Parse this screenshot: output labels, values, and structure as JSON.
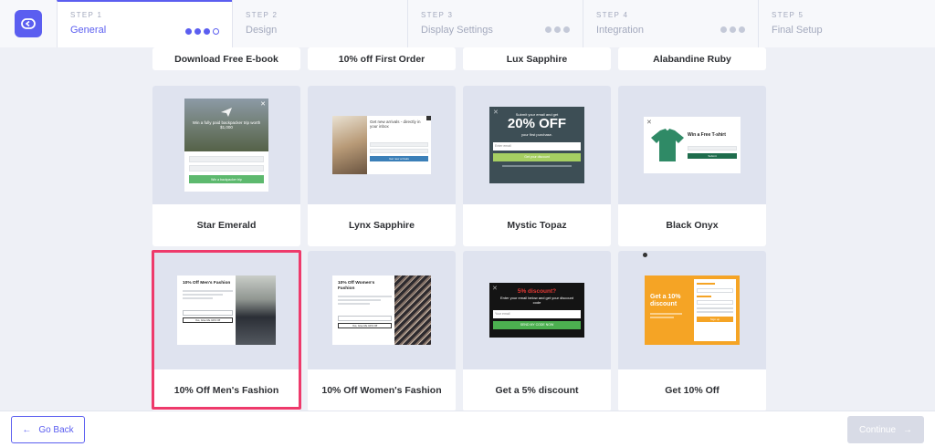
{
  "steps": [
    {
      "num": "STEP 1",
      "label": "General",
      "active": true
    },
    {
      "num": "STEP 2",
      "label": "Design"
    },
    {
      "num": "STEP 3",
      "label": "Display Settings"
    },
    {
      "num": "STEP 4",
      "label": "Integration"
    },
    {
      "num": "STEP 5",
      "label": "Final Setup"
    }
  ],
  "templates": {
    "row0": [
      "Download Free E-book",
      "10% off First Order",
      "Lux Sapphire",
      "Alabandine Ruby"
    ],
    "row1": [
      "Star Emerald",
      "Lynx Sapphire",
      "Mystic Topaz",
      "Black Onyx"
    ],
    "row2": [
      "10% Off Men's Fashion",
      "10% Off Women's Fashion",
      "Get a 5% discount",
      "Get 10% Off"
    ],
    "selected": "10% Off Men's Fashion"
  },
  "previews": {
    "star_emerald": {
      "headline": "Win a fully paid backpacker trip worth $1,000",
      "button": "Win a backpacker trip"
    },
    "lynx_sapphire": {
      "headline": "Get new arrivals - directly in your inbox",
      "button": "Get new arrivals"
    },
    "mystic_topaz": {
      "top": "Submit your email and get",
      "big": "20% OFF",
      "sub": "your first purchase.",
      "placeholder": "Enter email",
      "button": "Get your discount"
    },
    "black_onyx": {
      "headline": "Win a Free T-shirt",
      "button": "Submit"
    },
    "mens": {
      "title": "10% Off Men's Fashion",
      "button": "Yes, Give Me 10% Off"
    },
    "womens": {
      "title": "10% Off Women's Fashion",
      "button": "Yes, Give Me 10% Off"
    },
    "five": {
      "title": "5% discount?",
      "body": "Enter your email below and get your discount code",
      "placeholder": "Your email",
      "button": "SEND MY CODE NOW"
    },
    "ten": {
      "title": "Get a 10% discount",
      "button": "Sign up"
    }
  },
  "colors": {
    "accent": "#5b5ef0",
    "selected_border": "#ee3a6b",
    "thumb_bg": "#dfe3ef"
  },
  "footer": {
    "back": "Go Back",
    "continue": "Continue"
  }
}
